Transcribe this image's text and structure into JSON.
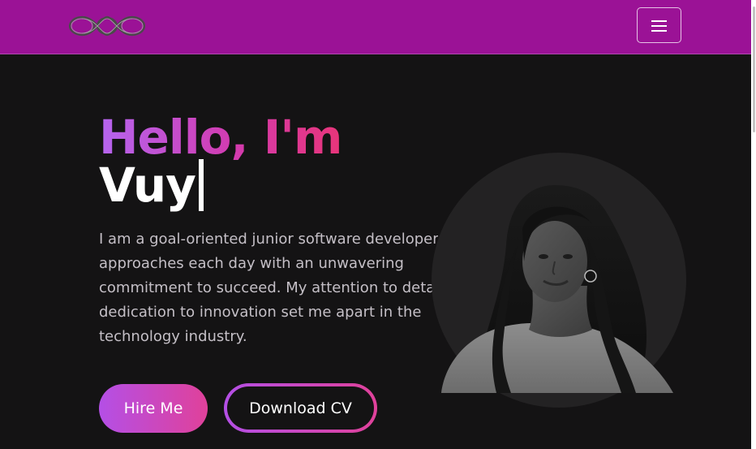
{
  "brand": {
    "logo_icon": "infinity-rings-logo",
    "navbar_color": "#9b1296"
  },
  "navbar": {
    "menu_icon": "hamburger-menu-icon"
  },
  "hero": {
    "greeting": "Hello, I'm",
    "typed_name": "Vuy",
    "intro": "I am a goal-oriented junior software developer who approaches each day with an unwavering commitment to succeed. My attention to detail and dedication to innovation set me apart in the technology industry.",
    "gradient_colors": [
      "#b565ef",
      "#d23bb0",
      "#e8357a"
    ]
  },
  "actions": {
    "hire_label": "Hire Me",
    "download_label": "Download CV"
  },
  "portrait": {
    "alt": "portrait-photo"
  }
}
